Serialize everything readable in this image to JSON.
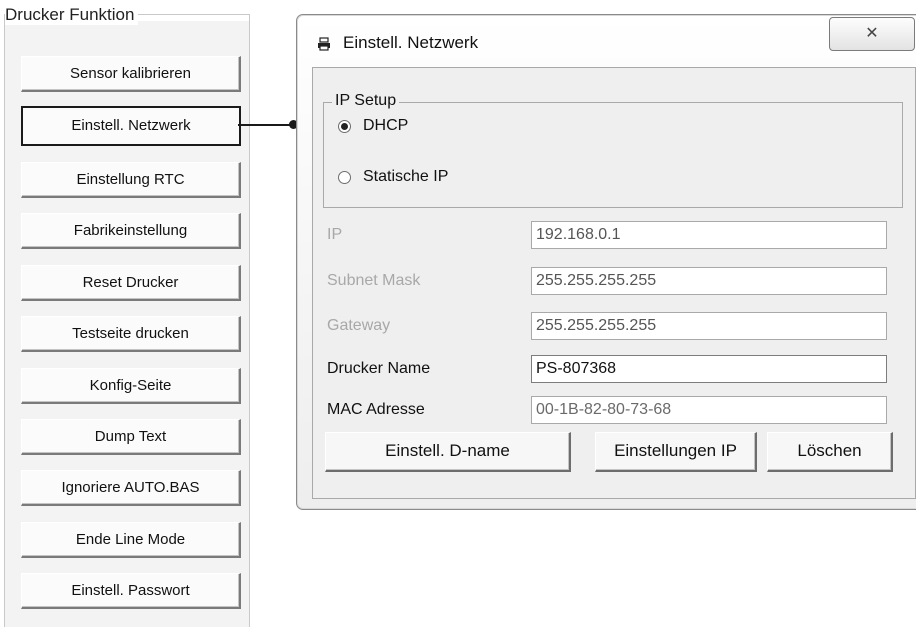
{
  "left_panel": {
    "title": "Drucker Funktion",
    "buttons": [
      "Sensor kalibrieren",
      "Einstell. Netzwerk",
      "Einstellung RTC",
      "Fabrikeinstellung",
      "Reset Drucker",
      "Testseite drucken",
      "Konfig-Seite",
      "Dump Text",
      "Ignoriere AUTO.BAS",
      "Ende Line Mode",
      "Einstell. Passwort"
    ],
    "selected": "Einstell. Netzwerk"
  },
  "dialog": {
    "icon": "printer-icon",
    "title": "Einstell. Netzwerk",
    "close_label": "✕",
    "ip_setup": {
      "title": "IP Setup",
      "options": [
        {
          "label": "DHCP",
          "checked": true
        },
        {
          "label": "Statische IP",
          "checked": false
        }
      ]
    },
    "fields": {
      "ip": {
        "label": "IP",
        "value": "192.168.0.1"
      },
      "subnet": {
        "label": "Subnet Mask",
        "value": "255.255.255.255"
      },
      "gateway": {
        "label": "Gateway",
        "value": "255.255.255.255"
      },
      "printer_name": {
        "label": "Drucker Name",
        "value": "PS-807368"
      },
      "mac": {
        "label": "MAC Adresse",
        "value": "00-1B-82-80-73-68"
      }
    },
    "buttons": {
      "set_dname": "Einstell. D-name",
      "set_ip": "Einstellungen IP",
      "delete": "Löschen"
    }
  }
}
